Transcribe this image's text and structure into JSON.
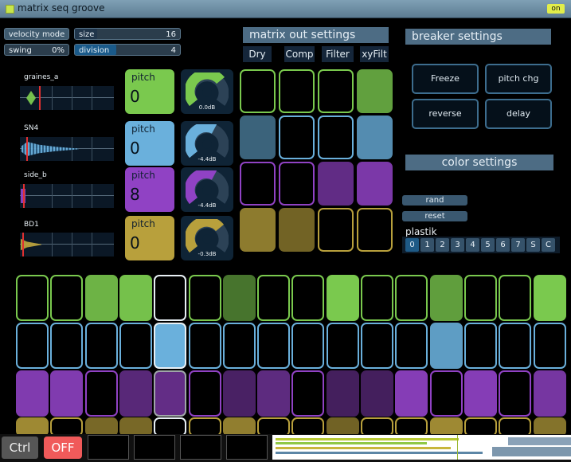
{
  "window": {
    "title": "matrix seq groove",
    "on_label": "on"
  },
  "top_controls": {
    "velocity_mode": "velocity mode",
    "size_label": "size",
    "size_value": "16",
    "swing_label": "swing",
    "swing_value": "0%",
    "division_label": "division",
    "division_value": "4"
  },
  "tracks": [
    {
      "name": "graines_a",
      "pitch_label": "pitch",
      "pitch_value": "0",
      "gain": "0.0dB",
      "color": "#7ac94e"
    },
    {
      "name": "SN4",
      "pitch_label": "pitch",
      "pitch_value": "0",
      "gain": "-4.4dB",
      "color": "#6ab0dc"
    },
    {
      "name": "side_b",
      "pitch_label": "pitch",
      "pitch_value": "8",
      "gain": "-4.4dB",
      "color": "#9042c4"
    },
    {
      "name": "BD1",
      "pitch_label": "pitch",
      "pitch_value": "0",
      "gain": "-0.3dB",
      "color": "#b8a03c"
    }
  ],
  "matrix_out": {
    "title": "matrix out settings",
    "columns": [
      "Dry",
      "Comp",
      "Filter",
      "xyFilt"
    ]
  },
  "breaker": {
    "title": "breaker settings",
    "buttons": [
      "Freeze",
      "pitch chg",
      "reverse",
      "delay"
    ]
  },
  "color_settings": {
    "title": "color settings",
    "rand_label": "rand",
    "reset_label": "reset",
    "preset_name": "plastik",
    "presets": [
      "0",
      "1",
      "2",
      "3",
      "4",
      "5",
      "6",
      "7",
      "S",
      "C"
    ],
    "active_preset": "0"
  },
  "bottom": {
    "ctrl_label": "Ctrl",
    "off_label": "OFF"
  },
  "colors": {
    "green": "#7ac94e",
    "blue": "#6ab0dc",
    "purple": "#9042c4",
    "gold": "#b8a03c"
  }
}
